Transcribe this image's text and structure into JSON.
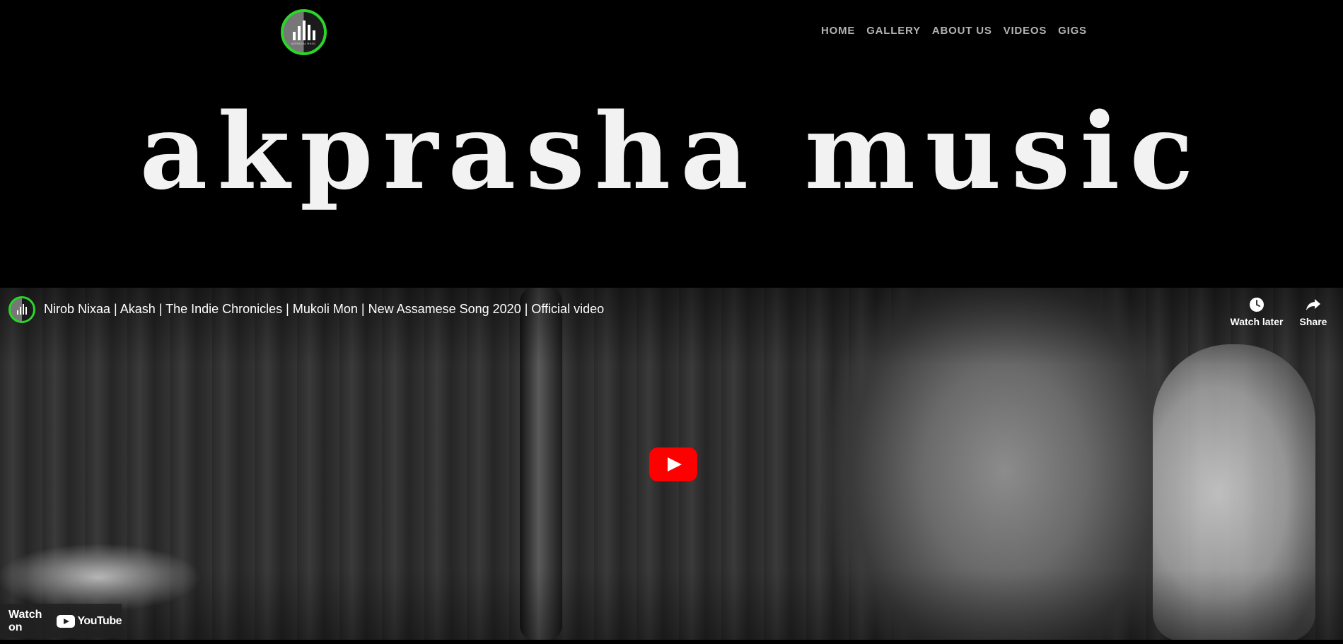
{
  "header": {
    "logo_text": "AKPRASHA MUSIC",
    "brand_title": "akprasha music",
    "nav": [
      {
        "label": "HOME"
      },
      {
        "label": "GALLERY"
      },
      {
        "label": "ABOUT US"
      },
      {
        "label": "VIDEOS"
      },
      {
        "label": "GIGS"
      }
    ]
  },
  "video": {
    "title": "Nirob Nixaa | Akash | The Indie Chronicles | Mukoli Mon | New Assamese Song 2020 | Official video",
    "watch_later_label": "Watch later",
    "share_label": "Share",
    "watch_on_label": "Watch on",
    "youtube_label": "YouTube"
  },
  "colors": {
    "background": "#000000",
    "logo_ring": "#2bd62b",
    "nav_text": "#b3b3b3",
    "play_button": "#ff0000"
  }
}
